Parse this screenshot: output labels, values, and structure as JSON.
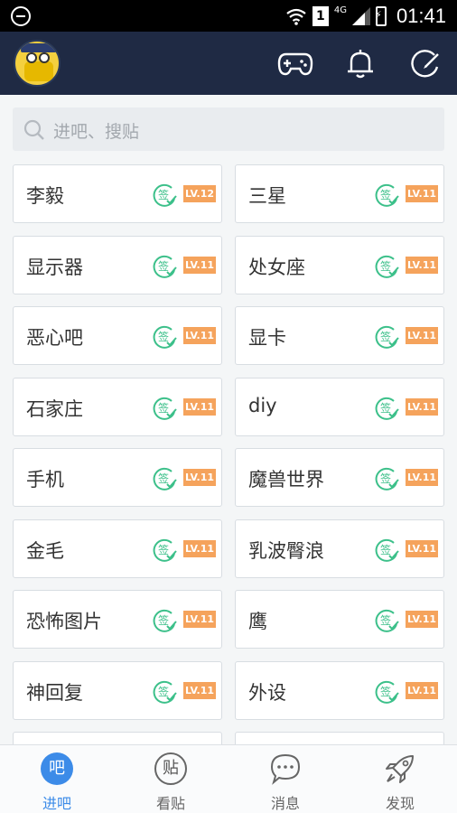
{
  "status": {
    "time": "01:41",
    "sim": "1",
    "network": "4G"
  },
  "search": {
    "placeholder": "进吧、搜贴"
  },
  "forums": [
    {
      "name": "李毅",
      "level": "LV.12"
    },
    {
      "name": "三星",
      "level": "LV.11"
    },
    {
      "name": "显示器",
      "level": "LV.11"
    },
    {
      "name": "处女座",
      "level": "LV.11"
    },
    {
      "name": "恶心吧",
      "level": "LV.11"
    },
    {
      "name": "显卡",
      "level": "LV.11"
    },
    {
      "name": "石家庄",
      "level": "LV.11"
    },
    {
      "name": "diy",
      "level": "LV.11"
    },
    {
      "name": "手机",
      "level": "LV.11"
    },
    {
      "name": "魔兽世界",
      "level": "LV.11"
    },
    {
      "name": "金毛",
      "level": "LV.11"
    },
    {
      "name": "乳波臀浪",
      "level": "LV.11"
    },
    {
      "name": "恐怖图片",
      "level": "LV.11"
    },
    {
      "name": "鹰",
      "level": "LV.11"
    },
    {
      "name": "神回复",
      "level": "LV.11"
    },
    {
      "name": "外设",
      "level": "LV.11"
    }
  ],
  "sign_label": "签",
  "tabs": [
    {
      "label": "进吧",
      "glyph": "吧",
      "icon": "forum-icon",
      "active": true
    },
    {
      "label": "看贴",
      "glyph": "贴",
      "icon": "post-icon",
      "active": false
    },
    {
      "label": "消息",
      "glyph": "",
      "icon": "message-icon",
      "active": false
    },
    {
      "label": "发现",
      "glyph": "",
      "icon": "rocket-icon",
      "active": false
    }
  ],
  "colors": {
    "header": "#1f2a44",
    "accent": "#3c8be8",
    "level_badge": "#f5a35c",
    "sign": "#3cc08a"
  }
}
